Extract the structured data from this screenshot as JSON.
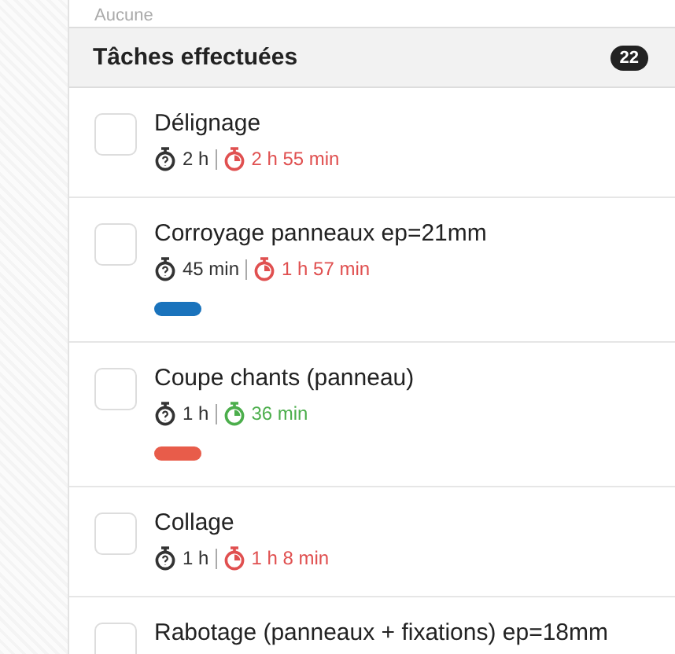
{
  "previous_section": {
    "text": "Aucune"
  },
  "section": {
    "title": "Tâches effectuées",
    "count": "22"
  },
  "tasks": [
    {
      "title": "Délignage",
      "checked": false,
      "estimated": "2 h",
      "actual": "2 h 55 min",
      "overdue": true
    },
    {
      "title": "Corroyage panneaux ep=21mm",
      "checked": false,
      "estimated": "45 min",
      "actual": "1 h 57 min",
      "overdue": true,
      "color": "#1a73bc"
    },
    {
      "title": "Coupe chants (panneau)",
      "checked": false,
      "estimated": "1 h",
      "actual": "36 min",
      "overdue": false,
      "color": "#e85c4a"
    },
    {
      "title": "Collage",
      "checked": false,
      "estimated": "1 h",
      "actual": "1 h 8 min",
      "overdue": true
    },
    {
      "title": "Rabotage (panneaux + fixations) ep=18mm",
      "checked": false
    }
  ]
}
